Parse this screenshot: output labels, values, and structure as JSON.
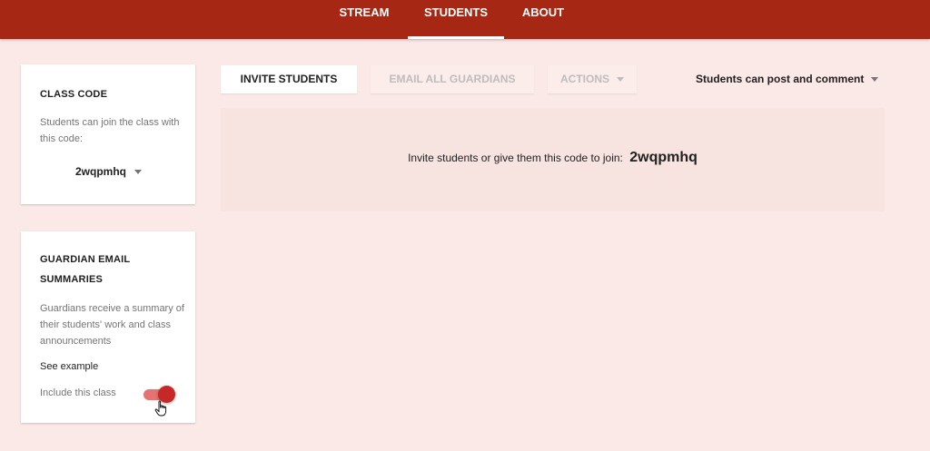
{
  "nav": {
    "tabs": [
      {
        "label": "STREAM"
      },
      {
        "label": "STUDENTS",
        "active": true
      },
      {
        "label": "ABOUT"
      }
    ],
    "color": "#a52714"
  },
  "class_code_card": {
    "title": "CLASS CODE",
    "description": "Students can join the class with this code:",
    "code": "2wqpmhq"
  },
  "guardian_card": {
    "title": "GUARDIAN EMAIL SUMMARIES",
    "description": "Guardians receive a summary of their students' work and class announcements",
    "see_example": "See example",
    "include_label": "Include this class",
    "include_enabled": true
  },
  "toolbar": {
    "invite_label": "INVITE STUDENTS",
    "email_label": "EMAIL ALL GUARDIANS",
    "actions_label": "ACTIONS",
    "permission_label": "Students can post and comment"
  },
  "invite_panel": {
    "message": "Invite students or give them this code to join:",
    "code": "2wqpmhq"
  },
  "colors": {
    "background": "#fbe9e7",
    "accent": "#c62828"
  }
}
